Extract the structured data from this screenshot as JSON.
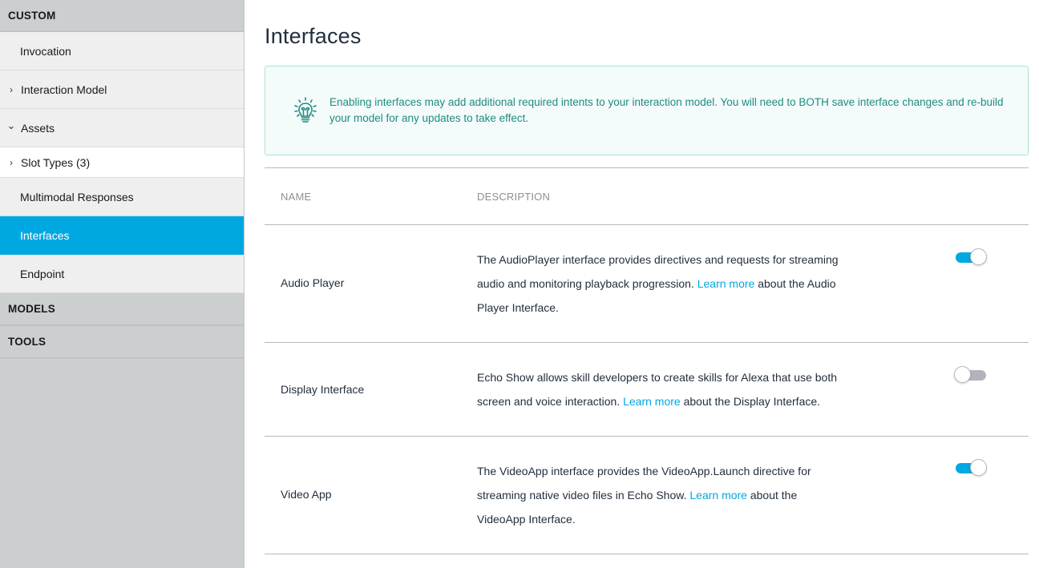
{
  "sidebar": {
    "sections": {
      "custom": "CUSTOM",
      "models": "MODELS",
      "tools": "TOOLS"
    },
    "items": [
      {
        "label": "Invocation",
        "chevron": ""
      },
      {
        "label": "Interaction Model",
        "chevron": "›"
      },
      {
        "label": "Assets",
        "chevron": "⌄"
      },
      {
        "label": "Slot Types (3)",
        "chevron": "›"
      },
      {
        "label": "Multimodal Responses",
        "chevron": ""
      },
      {
        "label": "Interfaces",
        "chevron": ""
      },
      {
        "label": "Endpoint",
        "chevron": ""
      }
    ],
    "active_item": "Interfaces",
    "accent_color": "#00a8e1"
  },
  "main": {
    "title": "Interfaces",
    "info": {
      "icon": "lightbulb-icon",
      "text": "Enabling interfaces may add additional required intents to your interaction model. You will need to BOTH save interface changes and re-build your model for any updates to take effect."
    },
    "table": {
      "headers": {
        "name": "NAME",
        "description": "DESCRIPTION"
      },
      "rows": [
        {
          "name": "Audio Player",
          "desc_before": "The AudioPlayer interface provides directives and requests for streaming audio and monitoring playback progression. ",
          "link": "Learn more",
          "desc_after": " about the Audio Player Interface.",
          "enabled": true
        },
        {
          "name": "Display Interface",
          "desc_before": "Echo Show allows skill developers to create skills for Alexa that use both screen and voice interaction. ",
          "link": "Learn more",
          "desc_after": " about the Display Interface.",
          "enabled": false
        },
        {
          "name": "Video App",
          "desc_before": "The VideoApp interface provides the VideoApp.Launch directive for streaming native video files in Echo Show. ",
          "link": "Learn more",
          "desc_after": " about the VideoApp Interface.",
          "enabled": true
        }
      ]
    }
  }
}
